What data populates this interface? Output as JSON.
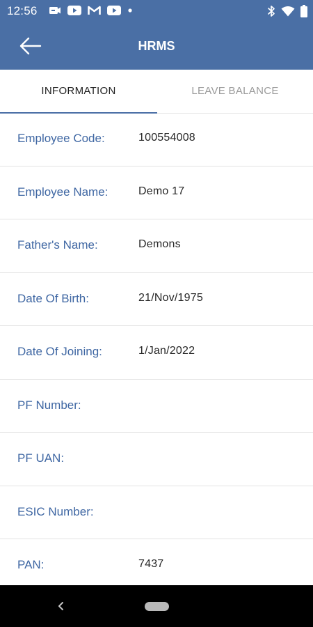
{
  "status_bar": {
    "time": "12:56",
    "left_icons": [
      "video-call-icon",
      "youtube-icon",
      "gmail-icon",
      "youtube-icon",
      "notification-dot-icon"
    ],
    "right_icons": [
      "bluetooth-icon",
      "wifi-icon",
      "battery-icon"
    ]
  },
  "header": {
    "title": "HRMS",
    "back_icon": "arrow-left-icon",
    "background_color": "#4a6fa5"
  },
  "tabs": [
    {
      "label": "INFORMATION",
      "active": true
    },
    {
      "label": "LEAVE BALANCE",
      "active": false
    }
  ],
  "info": {
    "rows": [
      {
        "label": "Employee Code:",
        "value": "100554008"
      },
      {
        "label": "Employee Name:",
        "value": "Demo 17"
      },
      {
        "label": "Father's Name:",
        "value": "Demons"
      },
      {
        "label": "Date Of Birth:",
        "value": "21/Nov/1975"
      },
      {
        "label": "Date Of Joining:",
        "value": "1/Jan/2022"
      },
      {
        "label": "PF Number:",
        "value": ""
      },
      {
        "label": "PF UAN:",
        "value": ""
      },
      {
        "label": "ESIC Number:",
        "value": ""
      },
      {
        "label": "PAN:",
        "value": "7437"
      }
    ]
  },
  "colors": {
    "accent": "#4a6fa5",
    "label_text": "#3f67a3",
    "value_text": "#262626",
    "inactive_tab": "#9a9a9a"
  }
}
